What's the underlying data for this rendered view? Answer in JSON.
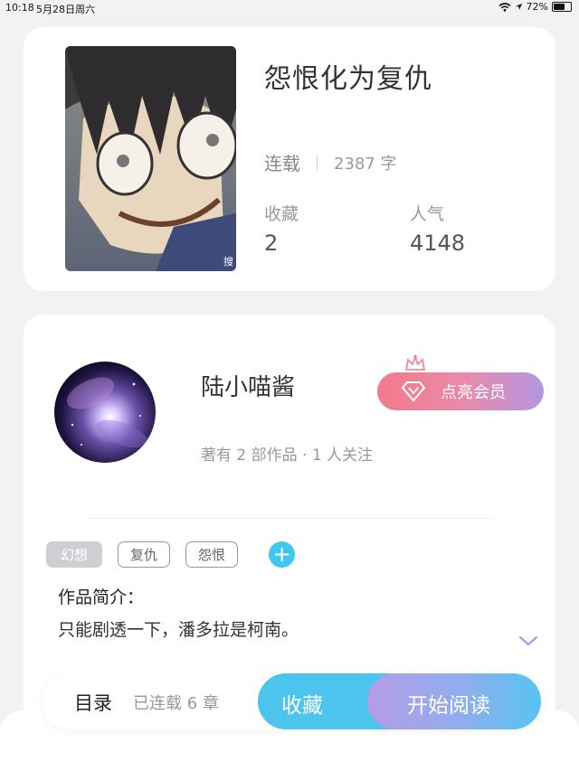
{
  "status_bar": {
    "time": "10:18",
    "date": "5月28日周六",
    "battery_percent": "72%",
    "battery_level": 0.72
  },
  "book": {
    "title": "怨恨化为复仇",
    "serial_status": "连载",
    "word_count": "2387 字",
    "favorites_label": "收藏",
    "favorites_value": "2",
    "popularity_label": "人气",
    "popularity_value": "4148",
    "cover_watermark": "搜"
  },
  "author": {
    "name": "陆小喵酱",
    "meta": "著有 2 部作品 · 1 人关注",
    "member_button": "点亮会员"
  },
  "tags": [
    "幻想",
    "复仇",
    "怨恨"
  ],
  "intro": {
    "title": "作品简介：",
    "text": "只能剧透一下，潘多拉是柯南。"
  },
  "bottom_bar": {
    "toc": "目录",
    "chapters": "已连载 6 章",
    "collect": "收藏",
    "read": "开始阅读"
  },
  "colors": {
    "accent_blue": "#3ec7ef",
    "member_gradient_start": "#f27a8a",
    "member_gradient_end": "#b596e4",
    "background": "#f2f2f4"
  },
  "icons": [
    "wifi-icon",
    "location-arrow-icon",
    "battery-icon",
    "crown-icon",
    "diamond-icon",
    "plus-icon",
    "chevron-down-icon"
  ]
}
